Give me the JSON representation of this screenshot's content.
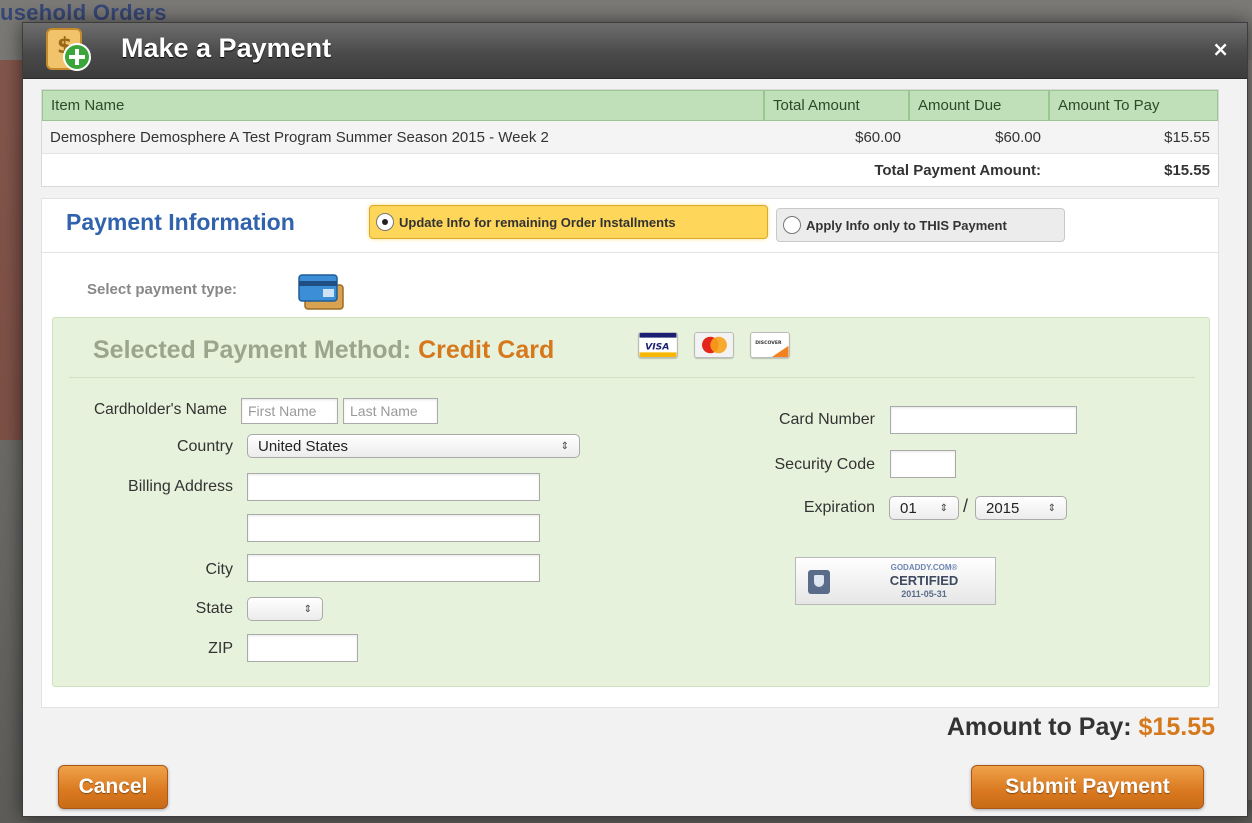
{
  "background": {
    "heading": "usehold Orders"
  },
  "modal": {
    "title": "Make a Payment",
    "close_glyph": "×",
    "icon": "payment-add-icon"
  },
  "items_table": {
    "headers": [
      "Item Name",
      "Total Amount",
      "Amount Due",
      "Amount To Pay"
    ],
    "rows": [
      {
        "name": "Demosphere Demosphere A Test Program Summer Season 2015 - Week 2",
        "total": "$60.00",
        "due": "$60.00",
        "pay": "$15.55"
      }
    ],
    "total_label": "Total Payment Amount:",
    "total_value": "$15.55"
  },
  "payment_info": {
    "title": "Payment Information",
    "option_update": "Update Info for remaining Order Installments",
    "option_only": "Apply Info only to THIS Payment",
    "selected_option": "update",
    "select_type_label": "Select payment type:",
    "type_icon": "credit-card-icon"
  },
  "method": {
    "label": "Selected Payment Method:",
    "value": "Credit Card",
    "card_icons": [
      "visa-icon",
      "mastercard-icon",
      "discover-icon"
    ]
  },
  "form": {
    "cardholder_label": "Cardholder's Name",
    "first_placeholder": "First Name",
    "last_placeholder": "Last Name",
    "country_label": "Country",
    "country_value": "United States",
    "billing_label": "Billing Address",
    "city_label": "City",
    "state_label": "State",
    "state_value": "",
    "zip_label": "ZIP",
    "card_number_label": "Card Number",
    "security_label": "Security Code",
    "expiration_label": "Expiration",
    "exp_month": "01",
    "exp_year": "2015",
    "exp_separator": "/",
    "select_arrow": "⇕"
  },
  "certification": {
    "line1": "GODADDY.COM®",
    "line2": "CERTIFIED",
    "line3": "2011-05-31"
  },
  "footer": {
    "amount_label": "Amount to Pay:",
    "amount_value": "$15.55",
    "cancel_label": "Cancel",
    "submit_label": "Submit Payment"
  },
  "colors": {
    "accent_orange": "#d6781c",
    "title_blue": "#3163ad",
    "panel_green": "#e7f2dc",
    "header_green": "#bfe0b8",
    "radio_yellow": "#fdd65a"
  }
}
